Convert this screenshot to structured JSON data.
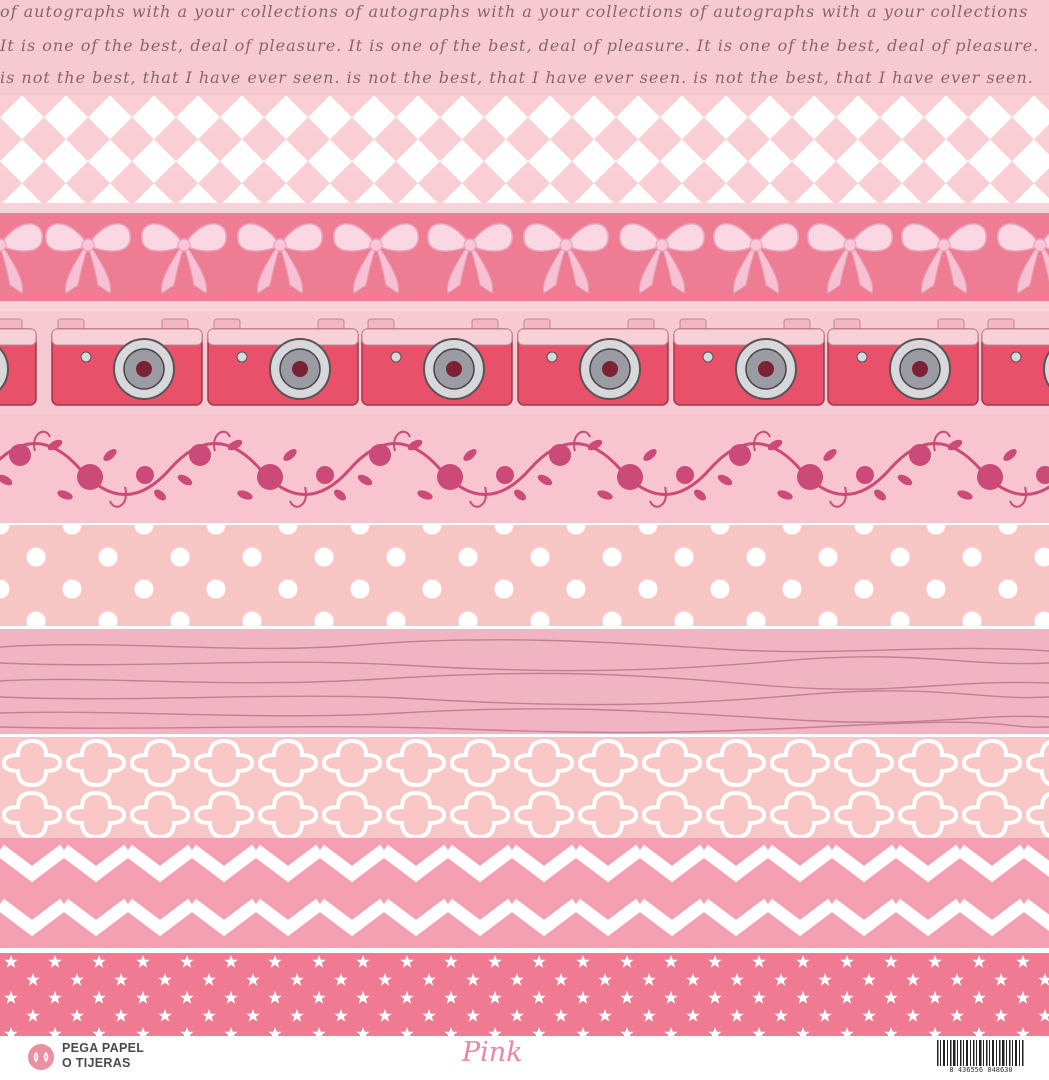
{
  "script_text": [
    "of autographs with a your collections of autographs with a your collections of autographs with a your collections",
    "It is one of the best, deal of pleasure. It is one of the best, deal of pleasure. It is one of the best, deal of pleasure.",
    "is not the best, that I have ever seen. is not the best, that I have ever seen. is not the best, that I have ever seen."
  ],
  "footer": {
    "brand_line1": "PEGA PAPEL",
    "brand_line2": "O TIJERAS",
    "title": "Pink",
    "barcode_number": "8 436556 048630"
  },
  "colors": {
    "strip_script": "#f7c9d2",
    "strip_bows": "#ee7d93",
    "strip_roses_motif": "#cc4a78",
    "strip_polka": "#f7c5c4",
    "strip_wood": "#f0b4c3",
    "strip_moroccan": "#f8c7c6",
    "strip_chevron": "#f49fb2",
    "strip_stars": "#ef7a92",
    "title": "#ea86a0"
  },
  "icons": [
    "bow-icon",
    "camera-icon",
    "rose-vine-icon",
    "star-icon",
    "logo-icon",
    "barcode-icon"
  ]
}
